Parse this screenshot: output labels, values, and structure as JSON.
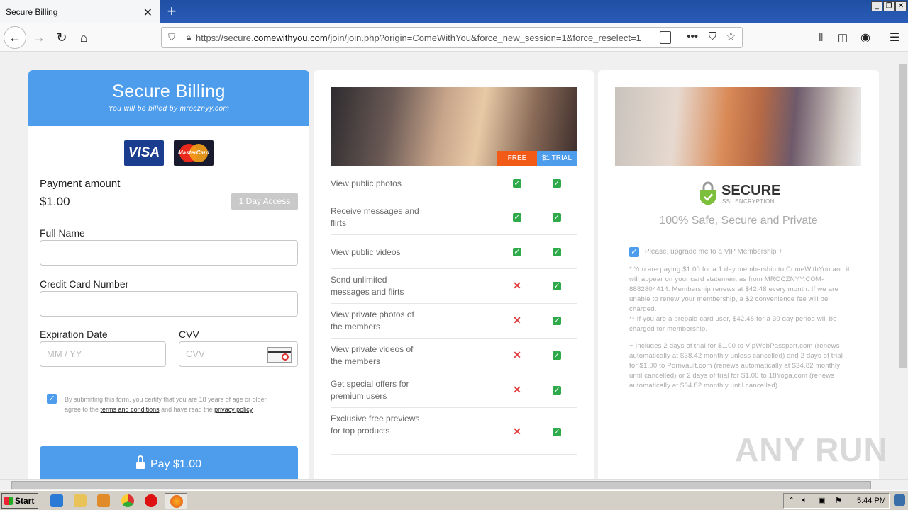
{
  "browser": {
    "tab_title": "Secure Billing",
    "tab_close": "✕",
    "new_tab": "+",
    "url_prefix": "https://secure.",
    "url_domain": "comewithyou.com",
    "url_rest": "/join/join.php?origin=ComeWithYou&force_new_session=1&force_reselect=1"
  },
  "billing": {
    "title": "Secure Billing",
    "subtitle": "You will be billed by mrocznyy.com",
    "visa": "VISA",
    "mastercard": "MasterCard",
    "payment_label": "Payment amount",
    "payment_value": "$1.00",
    "access_badge": "1 Day Access",
    "full_name_label": "Full Name",
    "cc_label": "Credit Card Number",
    "exp_label": "Expiration Date",
    "exp_placeholder": "MM / YY",
    "cvv_label": "CVV",
    "cvv_placeholder": "CVV",
    "terms_text_1": "By submitting this form, you certify that you are 18 years of age or older, agree to the ",
    "terms_link": "terms and conditions",
    "terms_text_2": " and have read the ",
    "privacy_link": "privacy policy",
    "pay_button": "Pay $1.00"
  },
  "features": {
    "free_tag": "FREE",
    "trial_tag": "$1 TRIAL",
    "rows": [
      {
        "label": "View public photos",
        "free": true,
        "trial": true
      },
      {
        "label": "Receive messages and flirts",
        "free": true,
        "trial": true
      },
      {
        "label": "View public videos",
        "free": true,
        "trial": true
      },
      {
        "label": "Send unlimited messages and flirts",
        "free": false,
        "trial": true
      },
      {
        "label": "View private photos of the members",
        "free": false,
        "trial": true
      },
      {
        "label": "View private videos of the members",
        "free": false,
        "trial": true
      },
      {
        "label": "Get special offers for premium users",
        "free": false,
        "trial": true
      },
      {
        "label": "Exclusive free previews for top products",
        "free": false,
        "trial": true
      }
    ]
  },
  "security": {
    "secure_big": "SECURE",
    "secure_small": "SSL ENCRYPTION",
    "safe_text": "100% Safe, Secure and Private",
    "vip_text": "Please, upgrade me to a VIP Membership +",
    "fine_1": "* You are paying $1.00 for a 1 day membership to ComeWithYou and it will appear on your card statement as from MROCZNYY.COM-8882804414. Membership renews at $42.48 every month. If we are unable to renew your membership, a $2 convenience fee will be charged.",
    "fine_2": "** If you are a prepaid card user, $42.48 for a 30 day period will be charged for membership.",
    "fine_3": "+ Includes 2 days of trial for $1.00 to VipWebPassport.com (renews automatically at $38.42 monthly unless cancelled) and 2 days of trial for $1.00 to Pornvault.com (renews automatically at $34.82 monthly until cancelled) or 2 days of trial for $1.00 to 18Yoga.com (renews automatically at $34.82 monthly until cancelled)."
  },
  "watermark": "ANY RUN",
  "taskbar": {
    "start": "Start",
    "clock": "5:44 PM"
  },
  "colors": {
    "accent": "#4e9ded",
    "free": "#f25a17",
    "check": "#2eaa4a",
    "cross": "#e23b3b"
  }
}
